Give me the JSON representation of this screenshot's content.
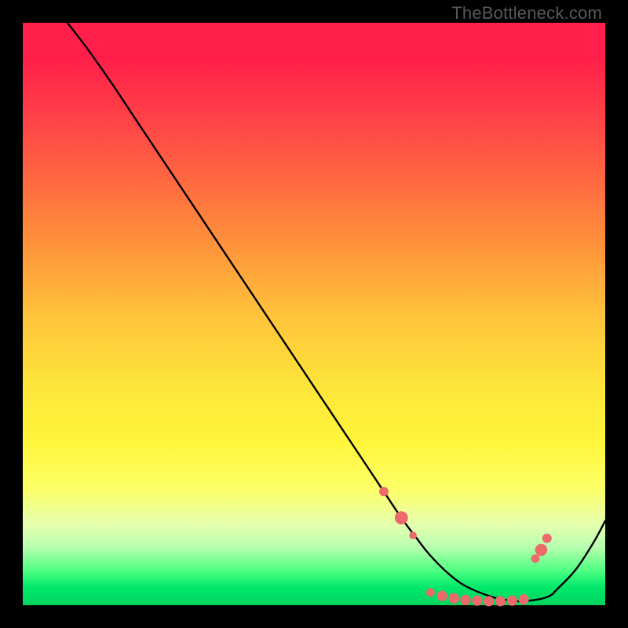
{
  "watermark": "TheBottleneck.com",
  "colors": {
    "background": "#000000",
    "curve": "#000000",
    "dots": "#ec6a6a"
  },
  "chart_data": {
    "type": "line",
    "title": "",
    "xlabel": "",
    "ylabel": "",
    "xlim": [
      0,
      100
    ],
    "ylim": [
      0,
      100
    ],
    "x": [
      0,
      5,
      10,
      15,
      20,
      25,
      30,
      35,
      40,
      45,
      50,
      55,
      60,
      62,
      65,
      68,
      70,
      73,
      76,
      80,
      83,
      86,
      90,
      92,
      95,
      98,
      100
    ],
    "values": [
      107,
      103,
      97,
      90,
      82.5,
      75,
      67.5,
      60,
      52.5,
      45,
      37.5,
      30,
      22.5,
      19.5,
      15,
      11,
      8.5,
      5.5,
      3.3,
      1.6,
      0.9,
      0.7,
      1.4,
      3.0,
      6.2,
      10.8,
      14.5
    ],
    "markers": [
      {
        "x": 62,
        "y": 19.5,
        "r": 1.0
      },
      {
        "x": 65,
        "y": 15.0,
        "r": 1.4
      },
      {
        "x": 67,
        "y": 12.0,
        "r": 0.8
      },
      {
        "x": 70,
        "y": 2.2,
        "r": 0.9
      },
      {
        "x": 72,
        "y": 1.6,
        "r": 1.1
      },
      {
        "x": 74,
        "y": 1.2,
        "r": 1.1
      },
      {
        "x": 76,
        "y": 0.9,
        "r": 1.1
      },
      {
        "x": 78,
        "y": 0.8,
        "r": 1.1
      },
      {
        "x": 80,
        "y": 0.7,
        "r": 1.1
      },
      {
        "x": 82,
        "y": 0.7,
        "r": 1.1
      },
      {
        "x": 84,
        "y": 0.8,
        "r": 1.1
      },
      {
        "x": 86,
        "y": 1.0,
        "r": 1.1
      },
      {
        "x": 88,
        "y": 8.0,
        "r": 0.9
      },
      {
        "x": 89,
        "y": 9.5,
        "r": 1.3
      },
      {
        "x": 90,
        "y": 11.5,
        "r": 1.0
      }
    ]
  }
}
